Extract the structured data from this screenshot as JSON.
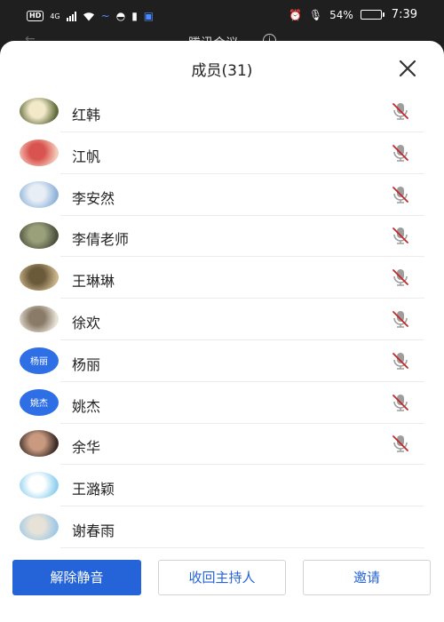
{
  "statusbar": {
    "network": "4G",
    "hd_badge": "HD",
    "battery_percent": "54%",
    "battery_level": 0.54,
    "time": "7:39"
  },
  "app": {
    "title": "腾讯会议"
  },
  "sheet": {
    "title": "成员(31)"
  },
  "members": [
    {
      "name": "红韩",
      "avatar": "photo",
      "avatar_colors": [
        "#5f6b3a",
        "#f2e9c9"
      ],
      "muted": true
    },
    {
      "name": "江帆",
      "avatar": "photo",
      "avatar_colors": [
        "#f4c9b8",
        "#d9534f"
      ],
      "muted": true
    },
    {
      "name": "李安然",
      "avatar": "photo",
      "avatar_colors": [
        "#8fb3d9",
        "#e8eef5"
      ],
      "muted": true
    },
    {
      "name": "李倩老师",
      "avatar": "photo",
      "avatar_colors": [
        "#4a4f3c",
        "#9aa07a"
      ],
      "muted": true
    },
    {
      "name": "王琳琳",
      "avatar": "photo",
      "avatar_colors": [
        "#c9b48a",
        "#6b5a3a"
      ],
      "muted": true
    },
    {
      "name": "徐欢",
      "avatar": "photo",
      "avatar_colors": [
        "#e8e2d6",
        "#8a7b68"
      ],
      "muted": true
    },
    {
      "name": "杨丽",
      "avatar": "text",
      "avatar_text": "杨丽",
      "muted": true
    },
    {
      "name": "姚杰",
      "avatar": "text",
      "avatar_text": "姚杰",
      "muted": true
    },
    {
      "name": "余华",
      "avatar": "photo",
      "avatar_colors": [
        "#3a2a24",
        "#c99a80"
      ],
      "muted": true
    },
    {
      "name": "王潞颖",
      "avatar": "photo",
      "avatar_colors": [
        "#8fd0ef",
        "#ffffff"
      ],
      "muted": false
    },
    {
      "name": "谢春雨",
      "avatar": "photo",
      "avatar_colors": [
        "#9ec9e8",
        "#e6e2d8"
      ],
      "muted": false
    }
  ],
  "footer": {
    "unmute_all": "解除静音",
    "reclaim_host": "收回主持人",
    "invite": "邀请"
  },
  "colors": {
    "accent": "#2563d8",
    "mic_muted": "#c62828",
    "mic_gray": "#9e9e9e"
  }
}
